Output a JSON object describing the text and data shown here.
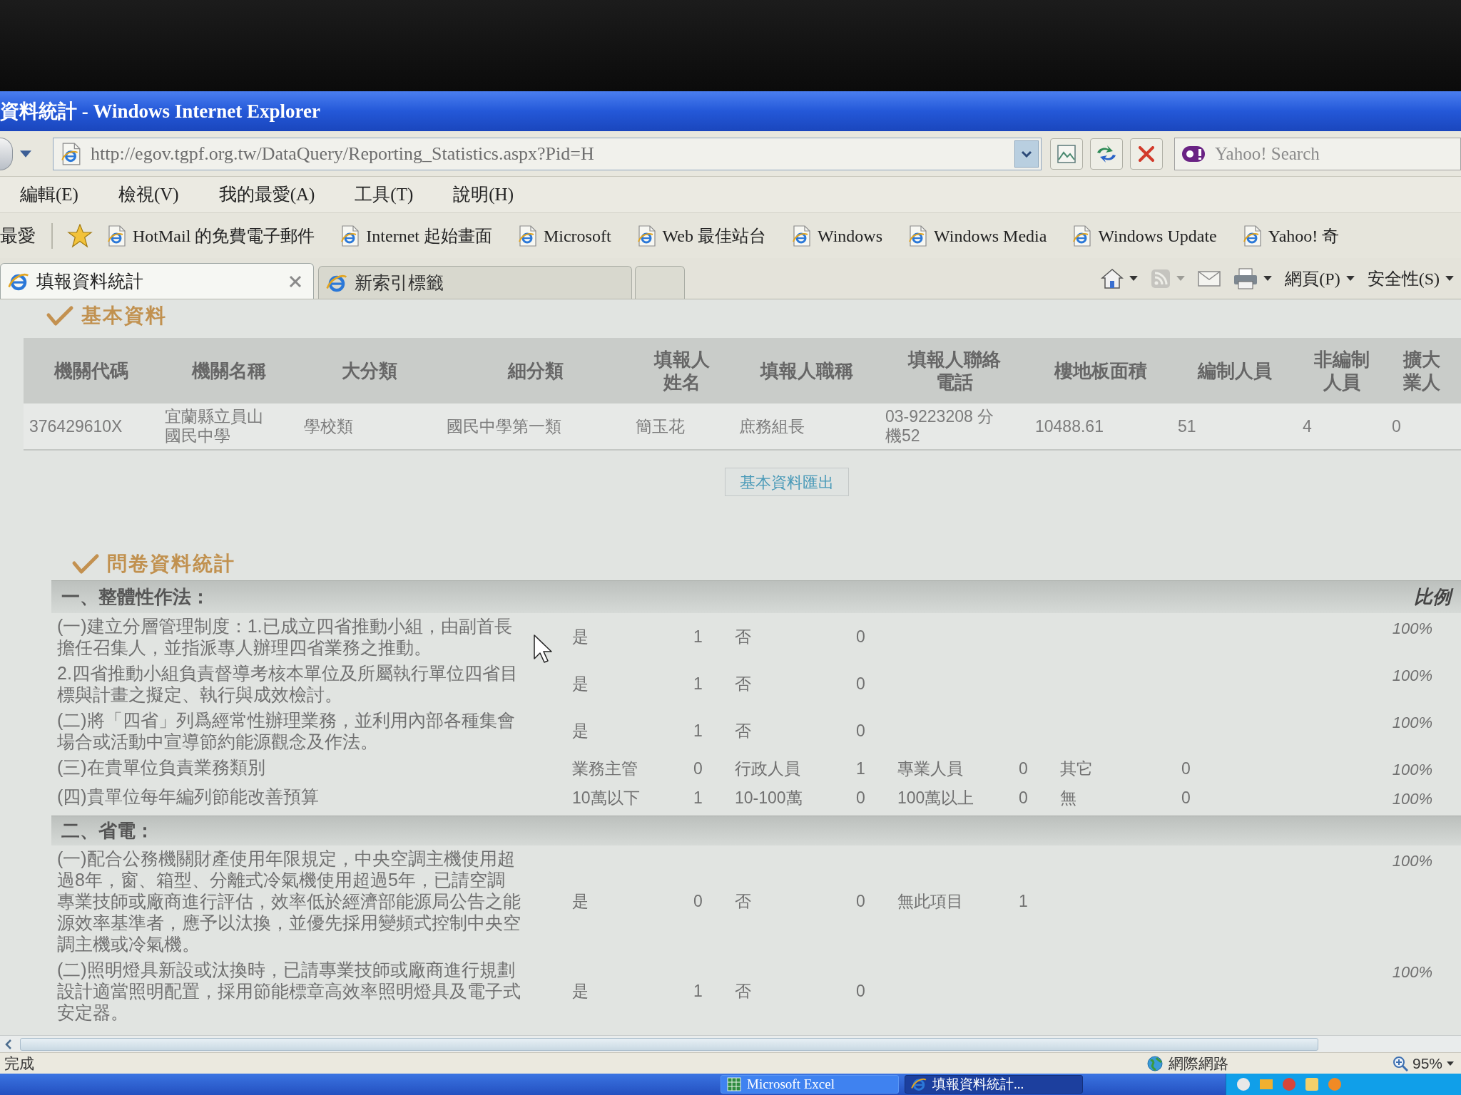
{
  "window": {
    "title": "資料統計 - Windows Internet Explorer"
  },
  "address_bar": {
    "url": "http://egov.tgpf.org.tw/DataQuery/Reporting_Statistics.aspx?Pid=H"
  },
  "search": {
    "placeholder": "Yahoo! Search"
  },
  "menu": [
    "編輯(E)",
    "檢視(V)",
    "我的最愛(A)",
    "工具(T)",
    "說明(H)"
  ],
  "favorites_bar": {
    "label": "最愛",
    "items": [
      "HotMail 的免費電子郵件",
      "Internet 起始畫面",
      "Microsoft",
      "Web 最佳站台",
      "Windows",
      "Windows Media",
      "Windows Update",
      "Yahoo! 奇"
    ]
  },
  "tabs": [
    {
      "label": "填報資料統計",
      "selected": true
    },
    {
      "label": "新索引標籤",
      "selected": false
    }
  ],
  "command_bar": {
    "tools": [
      {
        "kind": "home",
        "dropdown": true,
        "disabled": false
      },
      {
        "kind": "feeds",
        "dropdown": true,
        "disabled": true
      },
      {
        "kind": "mail",
        "dropdown": false,
        "disabled": false
      },
      {
        "kind": "print",
        "dropdown": true,
        "disabled": false
      }
    ],
    "menus": [
      "網頁(P)",
      "安全性(S)"
    ]
  },
  "basic_info": {
    "title": "基本資料",
    "columns": [
      "機關代碼",
      "機關名稱",
      "大分類",
      "細分類",
      "填報人姓名",
      "填報人職稱",
      "填報人聯絡電話",
      "樓地板面積",
      "編制人員",
      "非編制人員",
      "擴大業人"
    ],
    "rows": [
      [
        "376429610X",
        "宜蘭縣立員山國民中學",
        "學校類",
        "國民中學第一類",
        "簡玉花",
        "庶務組長",
        "03-9223208 分機52",
        "10488.61",
        "51",
        "4",
        "0"
      ]
    ],
    "export_button": "基本資料匯出"
  },
  "survey": {
    "title": "問卷資料統計",
    "sections": [
      {
        "heading": "一、整體性作法：",
        "ratio_header": "比例",
        "rows": [
          {
            "question": "(一)建立分層管理制度：1.已成立四省推動小組，由副首長擔任召集人，並指派專人辦理四省業務之推動。",
            "answers": [
              {
                "label": "是",
                "count": "1"
              },
              {
                "label": "否",
                "count": "0"
              }
            ],
            "ratio": "100%"
          },
          {
            "question": "2.四省推動小組負責督導考核本單位及所屬執行單位四省目標與計畫之擬定、執行與成效檢討。",
            "answers": [
              {
                "label": "是",
                "count": "1"
              },
              {
                "label": "否",
                "count": "0"
              }
            ],
            "ratio": "100%"
          },
          {
            "question": "(二)將「四省」列爲經常性辦理業務，並利用內部各種集會場合或活動中宣導節約能源觀念及作法。",
            "answers": [
              {
                "label": "是",
                "count": "1"
              },
              {
                "label": "否",
                "count": "0"
              }
            ],
            "ratio": "100%"
          },
          {
            "question": "(三)在貴單位負責業務類別",
            "answers": [
              {
                "label": "業務主管",
                "count": "0"
              },
              {
                "label": "行政人員",
                "count": "1"
              },
              {
                "label": "專業人員",
                "count": "0"
              },
              {
                "label": "其它",
                "count": "0"
              }
            ],
            "ratio": "100%"
          },
          {
            "question": "(四)貴單位每年編列節能改善預算",
            "answers": [
              {
                "label": "10萬以下",
                "count": "1"
              },
              {
                "label": "10-100萬",
                "count": "0"
              },
              {
                "label": "100萬以上",
                "count": "0"
              },
              {
                "label": "無",
                "count": "0"
              }
            ],
            "ratio": "100%"
          }
        ]
      },
      {
        "heading": "二、省電：",
        "rows": [
          {
            "question": "(一)配合公務機關財產使用年限規定，中央空調主機使用超過8年，窗、箱型、分離式冷氣機使用超過5年，已請空調專業技師或廠商進行評估，效率低於經濟部能源局公告之能源效率基準者，應予以汰換，並優先採用變頻式控制中央空調主機或冷氣機。",
            "answers": [
              {
                "label": "是",
                "count": "0"
              },
              {
                "label": "否",
                "count": "0"
              },
              {
                "label": "無此項目",
                "count": "1"
              }
            ],
            "ratio": "100%"
          },
          {
            "question": "(二)照明燈具新設或汰換時，已請專業技師或廠商進行規劃設計適當照明配置，採用節能標章高效率照明燈具及電子式安定器。",
            "answers": [
              {
                "label": "是",
                "count": "1"
              },
              {
                "label": "否",
                "count": "0"
              }
            ],
            "ratio": "100%"
          }
        ]
      }
    ]
  },
  "status_bar": {
    "text": "完成",
    "zone": "網際網路",
    "zoom": "95%"
  },
  "taskbar": {
    "windows": [
      {
        "kind": "spreadsheet",
        "label": "Microsoft Excel",
        "selected": false
      },
      {
        "kind": "browser",
        "label": "填報資料統計...",
        "selected": true
      }
    ]
  }
}
